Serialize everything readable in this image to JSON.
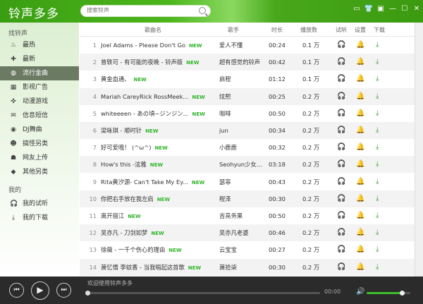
{
  "app": {
    "title": "铃声多多",
    "search_placeholder": "搜索铃声"
  },
  "window_buttons": [
    {
      "name": "message-icon",
      "glyph": "▭"
    },
    {
      "name": "skin-icon",
      "glyph": "👕"
    },
    {
      "name": "menu-icon",
      "glyph": "▣"
    },
    {
      "name": "minimize-icon",
      "glyph": "—"
    },
    {
      "name": "maximize-icon",
      "glyph": "☐"
    },
    {
      "name": "close-icon",
      "glyph": "✕"
    }
  ],
  "sidebar": {
    "section1": "找铃声",
    "items": [
      {
        "label": "最热",
        "icon": "fire-icon",
        "glyph": "♨"
      },
      {
        "label": "最新",
        "icon": "new-icon",
        "glyph": "✚"
      },
      {
        "label": "流行金曲",
        "icon": "globe-icon",
        "glyph": "◍",
        "selected": true
      },
      {
        "label": "影视广告",
        "icon": "film-icon",
        "glyph": "▦"
      },
      {
        "label": "动漫游戏",
        "icon": "gamepad-icon",
        "glyph": "✜"
      },
      {
        "label": "信息短信",
        "icon": "message-icon",
        "glyph": "✉"
      },
      {
        "label": "DJ舞曲",
        "icon": "dj-icon",
        "glyph": "◉"
      },
      {
        "label": "搞怪另类",
        "icon": "funny-icon",
        "glyph": "☻"
      },
      {
        "label": "网友上传",
        "icon": "users-icon",
        "glyph": "☗"
      },
      {
        "label": "其他另类",
        "icon": "tag-icon",
        "glyph": "◆"
      }
    ],
    "section2": "我的",
    "my_items": [
      {
        "label": "我的试听",
        "icon": "headphones-icon",
        "glyph": "🎧"
      },
      {
        "label": "我的下载",
        "icon": "download-icon",
        "glyph": "⤓"
      }
    ]
  },
  "table": {
    "columns": {
      "name": "歌曲名",
      "singer": "歌手",
      "duration": "时长",
      "plays": "播放数",
      "listen": "试听",
      "settings": "设置",
      "download": "下载"
    },
    "new_badge": "NEW",
    "rows": [
      {
        "n": "1",
        "name": "Joel Adams - Please Don't Go",
        "singer": "爱人不懂",
        "dur": "00:24",
        "plays": "0.1 万"
      },
      {
        "n": "2",
        "name": "曾轶可 - 有可能的夜晚 - 铃声版",
        "singer": "超有感觉的铃声",
        "dur": "00:42",
        "plays": "0.1 万"
      },
      {
        "n": "3",
        "name": "黄金血通、",
        "singer": "启程",
        "dur": "01:12",
        "plays": "0.1 万"
      },
      {
        "n": "4",
        "name": "Mariah CareyRick RossMeek...",
        "singer": "炫熙",
        "dur": "00:25",
        "plays": "0.2 万"
      },
      {
        "n": "5",
        "name": "whiteeeen - あの頃~ジンジン...",
        "singer": "咖啡",
        "dur": "00:50",
        "plays": "0.2 万"
      },
      {
        "n": "6",
        "name": "梁咏琪 - 顺时针",
        "singer": "jun",
        "dur": "00:34",
        "plays": "0.2 万"
      },
      {
        "n": "7",
        "name": "好可爱哦！ (^ω^)",
        "singer": "小鹿鹿",
        "dur": "00:32",
        "plays": "0.2 万"
      },
      {
        "n": "8",
        "name": "How's this -泫雅",
        "singer": "Seohyun少女...",
        "dur": "03:18",
        "plays": "0.2 万"
      },
      {
        "n": "9",
        "name": "Rita黄汐源- Can't Take My Ey...",
        "singer": "瑟菲",
        "dur": "00:43",
        "plays": "0.2 万"
      },
      {
        "n": "10",
        "name": "你把右手放在我左肩",
        "singer": "程泽",
        "dur": "00:30",
        "plays": "0.2 万"
      },
      {
        "n": "11",
        "name": "离开丽江",
        "singer": "吉亮务果",
        "dur": "00:50",
        "plays": "0.2 万"
      },
      {
        "n": "12",
        "name": "吴亦凡 - 刀剑如梦",
        "singer": "吴亦凡老婆",
        "dur": "00:46",
        "plays": "0.2 万"
      },
      {
        "n": "13",
        "name": "徐薇 - 一千个伤心的理由",
        "singer": "云宝宝",
        "dur": "00:27",
        "plays": "0.2 万"
      },
      {
        "n": "14",
        "name": "萧忆情  李蚊香 - 当我唱起这首歌",
        "singer": "萧拾柒",
        "dur": "00:30",
        "plays": "0.2 万"
      }
    ]
  },
  "player": {
    "status": "欢迎使用铃声多多",
    "time": "00:00",
    "progress": 0,
    "volume": 0.8
  },
  "colors": {
    "accent": "#3aa62c",
    "header": "#46a81a",
    "player_bg": "#2b2b2b"
  }
}
